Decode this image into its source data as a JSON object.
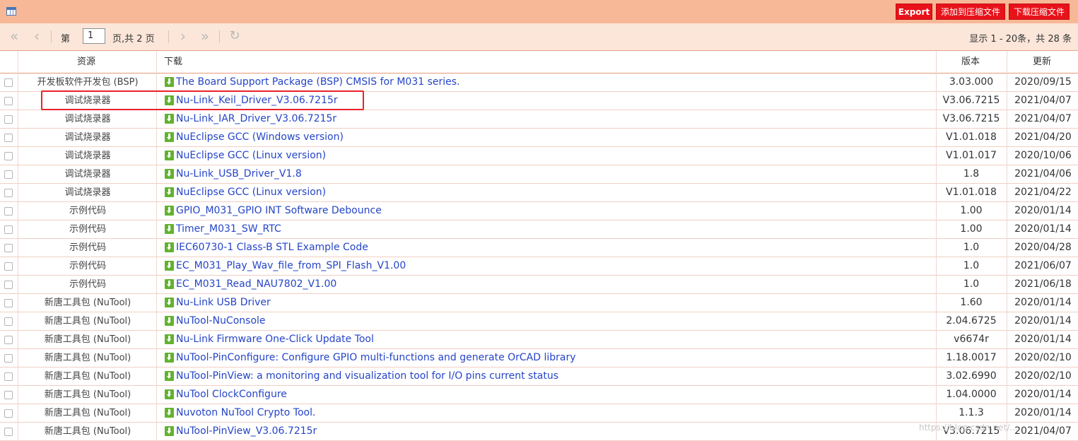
{
  "toolbar": {
    "export_label": "Export",
    "add_zip_label": "添加到压缩文件",
    "download_zip_label": "下载压缩文件"
  },
  "pager": {
    "page_prefix": "第",
    "current_page": "1",
    "page_suffix": "页,共 2 页",
    "info": "显示 1 - 20条，共 28 条"
  },
  "columns": {
    "resource": "资源",
    "download": "下载",
    "version": "版本",
    "updated": "更新"
  },
  "rows": [
    {
      "category": "开发板软件开发包 (BSP)",
      "name": "The Board Support Package (BSP) CMSIS for M031 series.",
      "version": "3.03.000",
      "date": "2020/09/15"
    },
    {
      "category": "调试烧录器",
      "name": "Nu-Link_Keil_Driver_V3.06.7215r",
      "version": "V3.06.7215",
      "date": "2021/04/07"
    },
    {
      "category": "调试烧录器",
      "name": "Nu-Link_IAR_Driver_V3.06.7215r",
      "version": "V3.06.7215",
      "date": "2021/04/07"
    },
    {
      "category": "调试烧录器",
      "name": "NuEclipse GCC (Windows version)",
      "version": "V1.01.018",
      "date": "2021/04/20"
    },
    {
      "category": "调试烧录器",
      "name": "NuEclipse GCC (Linux version)",
      "version": "V1.01.017",
      "date": "2020/10/06"
    },
    {
      "category": "调试烧录器",
      "name": "Nu-Link_USB_Driver_V1.8",
      "version": "1.8",
      "date": "2021/04/06"
    },
    {
      "category": "调试烧录器",
      "name": "NuEclipse GCC (Linux version)",
      "version": "V1.01.018",
      "date": "2021/04/22"
    },
    {
      "category": "示例代码",
      "name": "GPIO_M031_GPIO INT Software Debounce",
      "version": "1.00",
      "date": "2020/01/14"
    },
    {
      "category": "示例代码",
      "name": "Timer_M031_SW_RTC",
      "version": "1.00",
      "date": "2020/01/14"
    },
    {
      "category": "示例代码",
      "name": "IEC60730-1 Class-B STL Example Code",
      "version": "1.0",
      "date": "2020/04/28"
    },
    {
      "category": "示例代码",
      "name": "EC_M031_Play_Wav_file_from_SPI_Flash_V1.00",
      "version": "1.0",
      "date": "2021/06/07"
    },
    {
      "category": "示例代码",
      "name": "EC_M031_Read_NAU7802_V1.00",
      "version": "1.0",
      "date": "2021/06/18"
    },
    {
      "category": "新唐工具包 (NuTool)",
      "name": "Nu-Link USB Driver",
      "version": "1.60",
      "date": "2020/01/14"
    },
    {
      "category": "新唐工具包 (NuTool)",
      "name": "NuTool-NuConsole",
      "version": "2.04.6725",
      "date": "2020/01/14"
    },
    {
      "category": "新唐工具包 (NuTool)",
      "name": "Nu-Link Firmware One-Click Update Tool",
      "version": "v6674r",
      "date": "2020/01/14"
    },
    {
      "category": "新唐工具包 (NuTool)",
      "name": "NuTool-PinConfigure: Configure GPIO multi-functions and generate OrCAD library",
      "version": "1.18.0017",
      "date": "2020/02/10"
    },
    {
      "category": "新唐工具包 (NuTool)",
      "name": "NuTool-PinView: a monitoring and visualization tool for I/O pins current status",
      "version": "3.02.6990",
      "date": "2020/02/10"
    },
    {
      "category": "新唐工具包 (NuTool)",
      "name": "NuTool ClockConfigure",
      "version": "1.04.0000",
      "date": "2020/01/14"
    },
    {
      "category": "新唐工具包 (NuTool)",
      "name": "Nuvoton NuTool Crypto Tool.",
      "version": "1.1.3",
      "date": "2020/01/14"
    },
    {
      "category": "新唐工具包 (NuTool)",
      "name": "NuTool-PinView_V3.06.7215r",
      "version": "V3.06.7215",
      "date": "2021/04/07"
    }
  ],
  "watermark": "https://blog.csdn.net/..."
}
